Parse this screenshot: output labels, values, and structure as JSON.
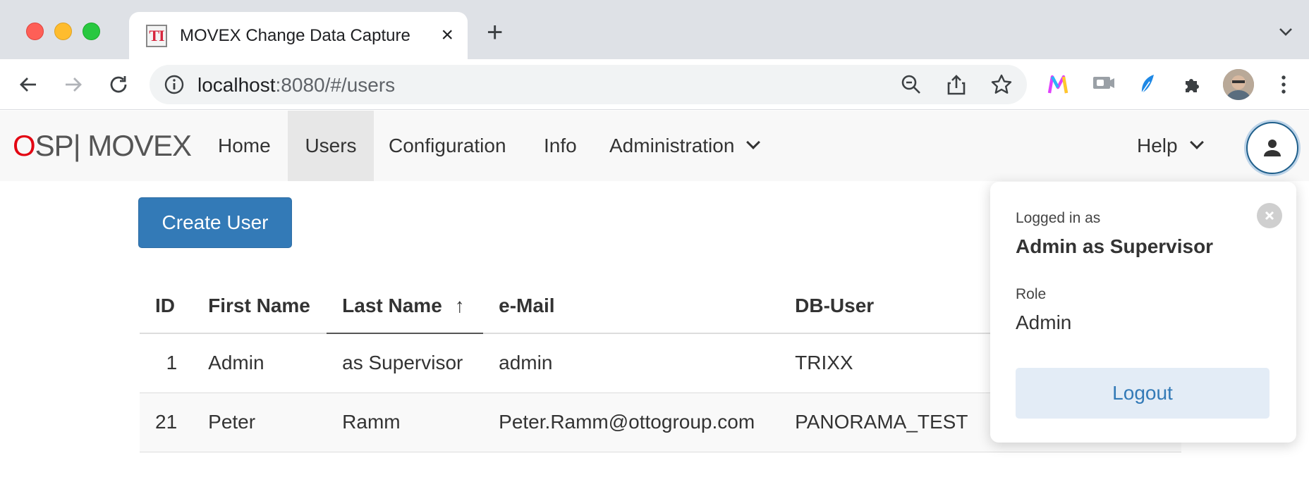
{
  "browser": {
    "tab_title": "MOVEX Change Data Capture",
    "favicon_text": "TI",
    "url_host": "localhost",
    "url_rest": ":8080/#/users"
  },
  "app": {
    "brand_o": "O",
    "brand_rest": "SP| MOVEX",
    "nav": {
      "home": "Home",
      "users": "Users",
      "configuration": "Configuration",
      "info": "Info",
      "administration": "Administration",
      "help": "Help"
    },
    "active_nav": "Users"
  },
  "main": {
    "create_user_label": "Create User",
    "table": {
      "headers": {
        "id": "ID",
        "first_name": "First Name",
        "last_name": "Last Name",
        "email": "e-Mail",
        "db_user": "DB-User"
      },
      "sort_indicator": "↑",
      "rows": [
        {
          "id": "1",
          "first_name": "Admin",
          "last_name": "as Supervisor",
          "email": "admin",
          "db_user": "TRIXX"
        },
        {
          "id": "21",
          "first_name": "Peter",
          "last_name": "Ramm",
          "email": "Peter.Ramm@ottogroup.com",
          "db_user": "PANORAMA_TEST"
        }
      ]
    }
  },
  "user_popover": {
    "logged_in_label": "Logged in as",
    "user_name": "Admin as Supervisor",
    "role_label": "Role",
    "role_value": "Admin",
    "logout_label": "Logout"
  },
  "colors": {
    "primary": "#337ab7",
    "brand_red": "#e30613",
    "navbar_bg": "#f8f8f8"
  }
}
